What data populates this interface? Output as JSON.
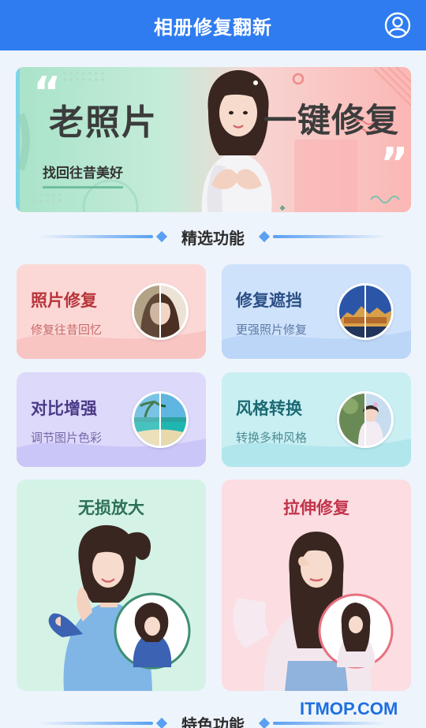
{
  "header": {
    "title": "相册修复翻新"
  },
  "banner": {
    "title_left": "老照片",
    "subtitle": "找回往昔美好",
    "title_right": "一键修复"
  },
  "sections": {
    "selected": "精选功能",
    "featured": "特色功能"
  },
  "cards": [
    {
      "title": "照片修复",
      "subtitle": "修复往昔回忆",
      "title_color": "#b8343a",
      "sub_color": "#c96a6a",
      "bg": "#fbd8d6",
      "thumb": "portrait"
    },
    {
      "title": "修复遮挡",
      "subtitle": "更强照片修复",
      "title_color": "#2b4f86",
      "sub_color": "#5b7aa8",
      "bg": "#cfe2fb",
      "thumb": "palace"
    },
    {
      "title": "对比增强",
      "subtitle": "调节图片色彩",
      "title_color": "#4b3a86",
      "sub_color": "#7867a8",
      "bg": "#dcd9fb",
      "thumb": "beach"
    },
    {
      "title": "风格转换",
      "subtitle": "转换多种风格",
      "title_color": "#1c6a73",
      "sub_color": "#4b8c93",
      "bg": "#c9eff3",
      "thumb": "girl"
    }
  ],
  "big_cards": [
    {
      "title": "无损放大",
      "title_color": "#2d6f55",
      "bg": "#d4f3e6"
    },
    {
      "title": "拉伸修复",
      "title_color": "#c2344a",
      "bg": "#fbdde2"
    }
  ],
  "watermark": "ITMOP.COM"
}
